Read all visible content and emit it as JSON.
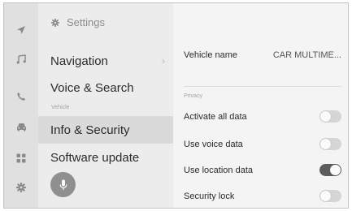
{
  "rail": {
    "icons": [
      "navigation-arrow-icon",
      "music-note-icon",
      "phone-icon",
      "car-icon",
      "apps-grid-icon",
      "gear-icon"
    ]
  },
  "menu": {
    "header": "Settings",
    "items": [
      {
        "label": "Navigation",
        "selected": false,
        "chevron": true
      },
      {
        "label": "Voice & Search",
        "selected": false,
        "chevron": false
      },
      {
        "label": "Info & Security",
        "selected": true,
        "chevron": false
      },
      {
        "label": "Software update",
        "selected": false,
        "chevron": false
      }
    ],
    "section_label": "Vehicle"
  },
  "content": {
    "vehicle_name_label": "Vehicle name",
    "vehicle_name_value": "CAR MULTIME...",
    "section_privacy": "Privacy",
    "rows": [
      {
        "label": "Activate all data",
        "on": false
      },
      {
        "label": "Use voice data",
        "on": false
      },
      {
        "label": "Use location data",
        "on": true
      },
      {
        "label": "Security lock",
        "on": false
      }
    ]
  },
  "colors": {
    "toggle_on": "#5c5c5c",
    "toggle_off": "#d5d5d5",
    "selected_bg": "#dadada"
  }
}
